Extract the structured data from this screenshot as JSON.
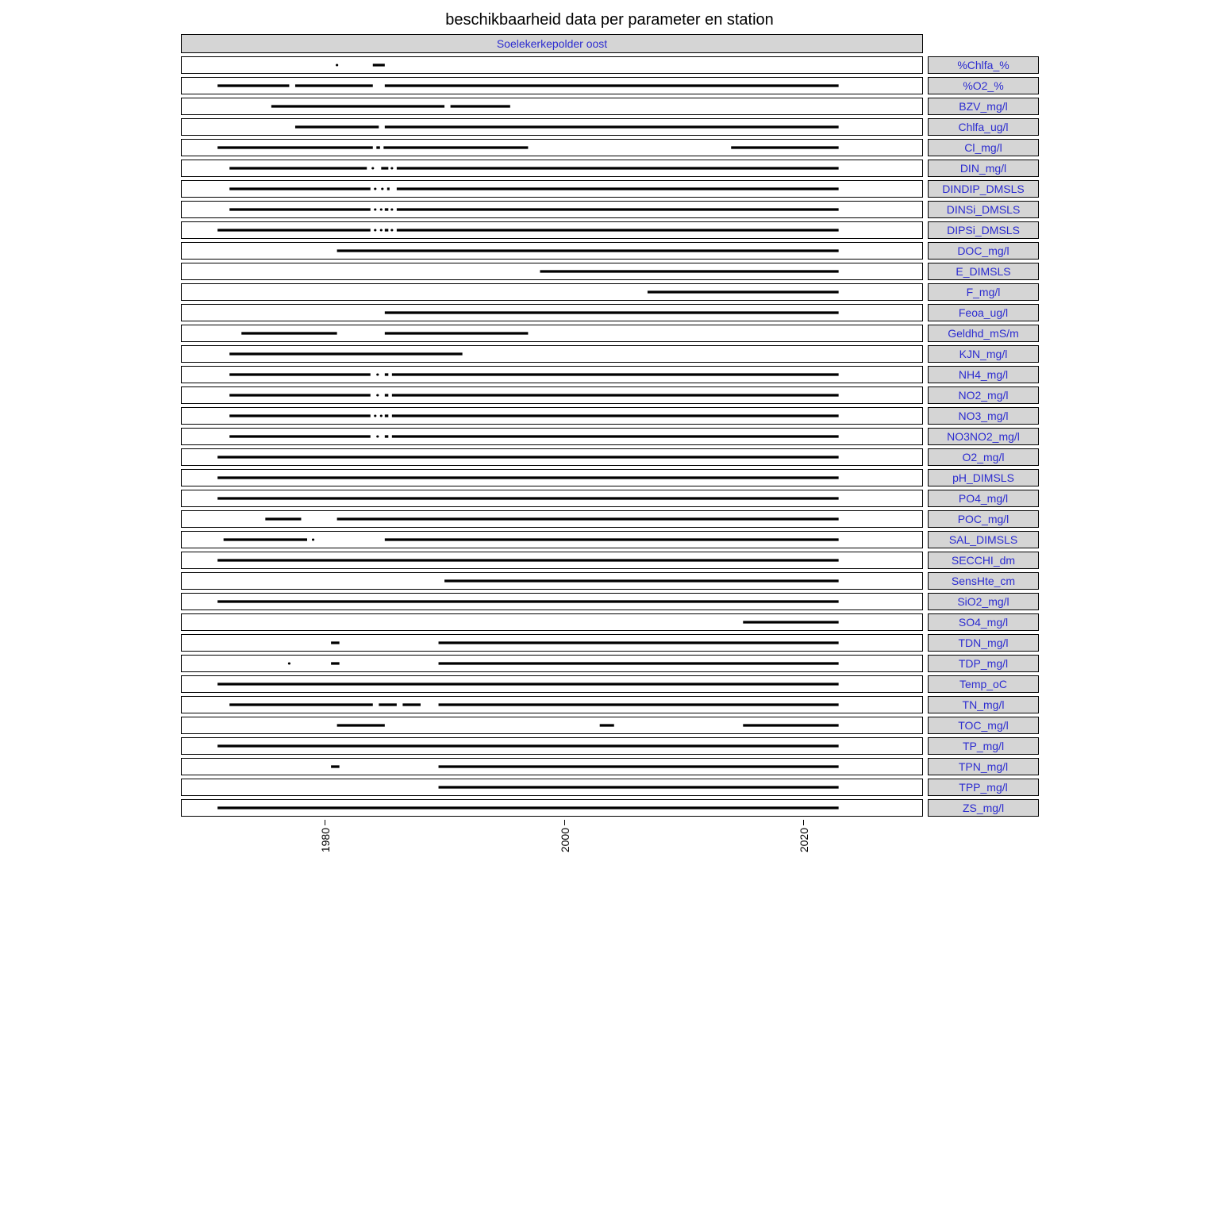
{
  "title": "beschikbaarheid data per parameter en station",
  "station": "Soelekerkepolder oost",
  "x_axis": {
    "min": 1968,
    "max": 2030,
    "ticks": [
      1980,
      2000,
      2020
    ]
  },
  "chart_data": {
    "type": "scatter",
    "title": "beschikbaarheid data per parameter en station",
    "xlabel": "",
    "ylabel": "",
    "xlim": [
      1968,
      2030
    ],
    "note": "Each strip shows approximate year-coverage segments (start,end) where observations exist for that parameter at station Soelekerkepolder oost. Isolated points are width-0 segments.",
    "series": [
      {
        "name": "%Chlfa_%",
        "segments": [
          [
            1981,
            1981
          ],
          [
            1984,
            1985
          ]
        ]
      },
      {
        "name": "%O2_%",
        "segments": [
          [
            1971,
            1977
          ],
          [
            1977.5,
            1984
          ],
          [
            1985,
            2023
          ]
        ]
      },
      {
        "name": "BZV_mg/l",
        "segments": [
          [
            1975.5,
            1990
          ],
          [
            1990.5,
            1995.5
          ]
        ]
      },
      {
        "name": "Chlfa_ug/l",
        "segments": [
          [
            1977.5,
            1984.5
          ],
          [
            1985,
            2023
          ]
        ]
      },
      {
        "name": "Cl_mg/l",
        "segments": [
          [
            1971,
            1984
          ],
          [
            1984.3,
            1984.6
          ],
          [
            1984.9,
            1997
          ],
          [
            2014,
            2023
          ]
        ]
      },
      {
        "name": "DIN_mg/l",
        "segments": [
          [
            1972,
            1983.5
          ],
          [
            1984,
            1984
          ],
          [
            1984.7,
            1985.3
          ],
          [
            1985.6,
            1985.6
          ],
          [
            1986,
            2023
          ]
        ]
      },
      {
        "name": "DINDIP_DMSLS",
        "segments": [
          [
            1972,
            1983.8
          ],
          [
            1984.2,
            1984.2
          ],
          [
            1984.8,
            1984.8
          ],
          [
            1985.2,
            1985.4
          ],
          [
            1986,
            2023
          ]
        ]
      },
      {
        "name": "DINSi_DMSLS",
        "segments": [
          [
            1972,
            1983.8
          ],
          [
            1984.2,
            1984.2
          ],
          [
            1984.7,
            1984.7
          ],
          [
            1985,
            1985.3
          ],
          [
            1985.6,
            1985.6
          ],
          [
            1986,
            2023
          ]
        ]
      },
      {
        "name": "DIPSi_DMSLS",
        "segments": [
          [
            1971,
            1983.8
          ],
          [
            1984.2,
            1984.2
          ],
          [
            1984.7,
            1984.7
          ],
          [
            1985,
            1985.3
          ],
          [
            1985.6,
            1985.6
          ],
          [
            1986,
            2023
          ]
        ]
      },
      {
        "name": "DOC_mg/l",
        "segments": [
          [
            1981,
            2023
          ]
        ]
      },
      {
        "name": "E_DIMSLS",
        "segments": [
          [
            1998,
            2023
          ]
        ]
      },
      {
        "name": "F_mg/l",
        "segments": [
          [
            2007,
            2023
          ]
        ]
      },
      {
        "name": "Feoa_ug/l",
        "segments": [
          [
            1985,
            2023
          ]
        ]
      },
      {
        "name": "Geldhd_mS/m",
        "segments": [
          [
            1973,
            1981
          ],
          [
            1985,
            1997
          ]
        ]
      },
      {
        "name": "KJN_mg/l",
        "segments": [
          [
            1972,
            1991.5
          ]
        ]
      },
      {
        "name": "NH4_mg/l",
        "segments": [
          [
            1972,
            1983.8
          ],
          [
            1984.4,
            1984.4
          ],
          [
            1985,
            1985.3
          ],
          [
            1985.6,
            2023
          ]
        ]
      },
      {
        "name": "NO2_mg/l",
        "segments": [
          [
            1972,
            1983.8
          ],
          [
            1984.4,
            1984.4
          ],
          [
            1985,
            1985.3
          ],
          [
            1985.6,
            2023
          ]
        ]
      },
      {
        "name": "NO3_mg/l",
        "segments": [
          [
            1972,
            1983.8
          ],
          [
            1984.2,
            1984.2
          ],
          [
            1984.7,
            1984.7
          ],
          [
            1985,
            1985.3
          ],
          [
            1985.6,
            2023
          ]
        ]
      },
      {
        "name": "NO3NO2_mg/l",
        "segments": [
          [
            1972,
            1983.8
          ],
          [
            1984.4,
            1984.4
          ],
          [
            1985,
            1985.3
          ],
          [
            1985.6,
            2023
          ]
        ]
      },
      {
        "name": "O2_mg/l",
        "segments": [
          [
            1971,
            2023
          ]
        ]
      },
      {
        "name": "pH_DIMSLS",
        "segments": [
          [
            1971,
            2023
          ]
        ]
      },
      {
        "name": "PO4_mg/l",
        "segments": [
          [
            1971,
            2023
          ]
        ]
      },
      {
        "name": "POC_mg/l",
        "segments": [
          [
            1975,
            1978
          ],
          [
            1981,
            2023
          ]
        ]
      },
      {
        "name": "SAL_DIMSLS",
        "segments": [
          [
            1971.5,
            1978.5
          ],
          [
            1979,
            1979
          ],
          [
            1985,
            2023
          ]
        ]
      },
      {
        "name": "SECCHI_dm",
        "segments": [
          [
            1971,
            2023
          ]
        ]
      },
      {
        "name": "SensHte_cm",
        "segments": [
          [
            1990,
            2023
          ]
        ]
      },
      {
        "name": "SiO2_mg/l",
        "segments": [
          [
            1971,
            2023
          ]
        ]
      },
      {
        "name": "SO4_mg/l",
        "segments": [
          [
            2015,
            2023
          ]
        ]
      },
      {
        "name": "TDN_mg/l",
        "segments": [
          [
            1980.5,
            1981.2
          ],
          [
            1989.5,
            2023
          ]
        ]
      },
      {
        "name": "TDP_mg/l",
        "segments": [
          [
            1977,
            1977
          ],
          [
            1980.5,
            1981.2
          ],
          [
            1989.5,
            2023
          ]
        ]
      },
      {
        "name": "Temp_oC",
        "segments": [
          [
            1971,
            2023
          ]
        ]
      },
      {
        "name": "TN_mg/l",
        "segments": [
          [
            1972,
            1984
          ],
          [
            1984.5,
            1986
          ],
          [
            1986.5,
            1988
          ],
          [
            1989.5,
            2023
          ]
        ]
      },
      {
        "name": "TOC_mg/l",
        "segments": [
          [
            1981,
            1985
          ],
          [
            2003,
            2004.2
          ],
          [
            2015,
            2023
          ]
        ]
      },
      {
        "name": "TP_mg/l",
        "segments": [
          [
            1971,
            2023
          ]
        ]
      },
      {
        "name": "TPN_mg/l",
        "segments": [
          [
            1980.5,
            1981.2
          ],
          [
            1989.5,
            2023
          ]
        ]
      },
      {
        "name": "TPP_mg/l",
        "segments": [
          [
            1989.5,
            2023
          ]
        ]
      },
      {
        "name": "ZS_mg/l",
        "segments": [
          [
            1971,
            2023
          ]
        ]
      }
    ]
  }
}
